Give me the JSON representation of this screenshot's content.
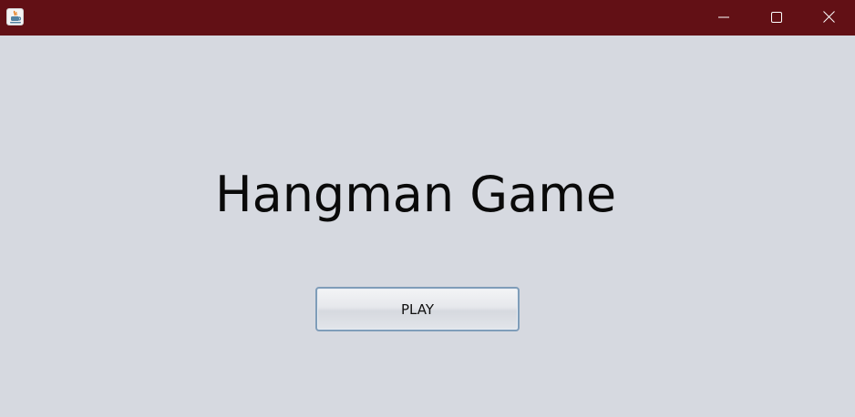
{
  "window": {
    "app_icon": "java-coffee-cup-icon",
    "titlebar_color": "#621015",
    "background_color": "#d6d9e0",
    "controls": {
      "minimize_icon": "minimize-icon",
      "maximize_icon": "maximize-icon",
      "close_icon": "close-icon"
    }
  },
  "main": {
    "title": "Hangman Game",
    "play_label": "PLAY",
    "button_border_color": "#7f9db9"
  }
}
